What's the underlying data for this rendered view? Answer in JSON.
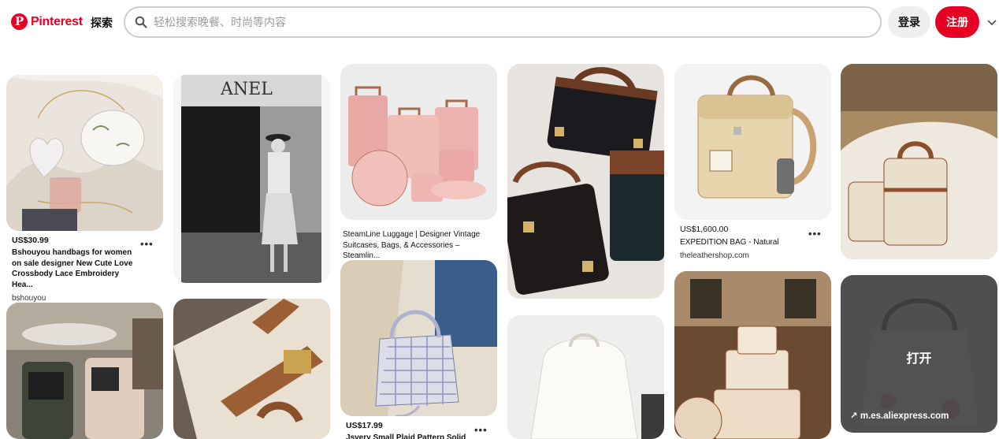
{
  "header": {
    "brand": "Pinterest",
    "explore_label": "探索",
    "search_placeholder": "轻松搜索晚餐、时尚等内容",
    "login_label": "登录",
    "signup_label": "注册",
    "brand_color": "#e60023"
  },
  "icons": {
    "logo": "pinterest-logo-icon",
    "search": "search-icon",
    "menu": "chevron-down-icon",
    "more": "more-dots-icon",
    "external": "external-link-icon"
  },
  "pins": [
    {
      "price": "US$30.99",
      "title": "Bshouyou handbags for women on sale designer New Cute Love Crossbody Lace Embroidery Hea...",
      "source": "bshouyou",
      "more": "•••"
    },
    {
      "title": "SteamLine Luggage | Designer Vintage Suitcases, Bags, & Accessories – Steamlin..."
    },
    {
      "price": "US$1,600.00",
      "title": "EXPEDITION BAG - Natural",
      "source": "theleathershop.com",
      "more": "•••"
    },
    {
      "price": "US$17.99",
      "title": "Jsvery Small Plaid Pattern Solid",
      "more": "•••"
    },
    {
      "open_label": "打开",
      "link_label": "m.es.aliexpress.com"
    }
  ]
}
